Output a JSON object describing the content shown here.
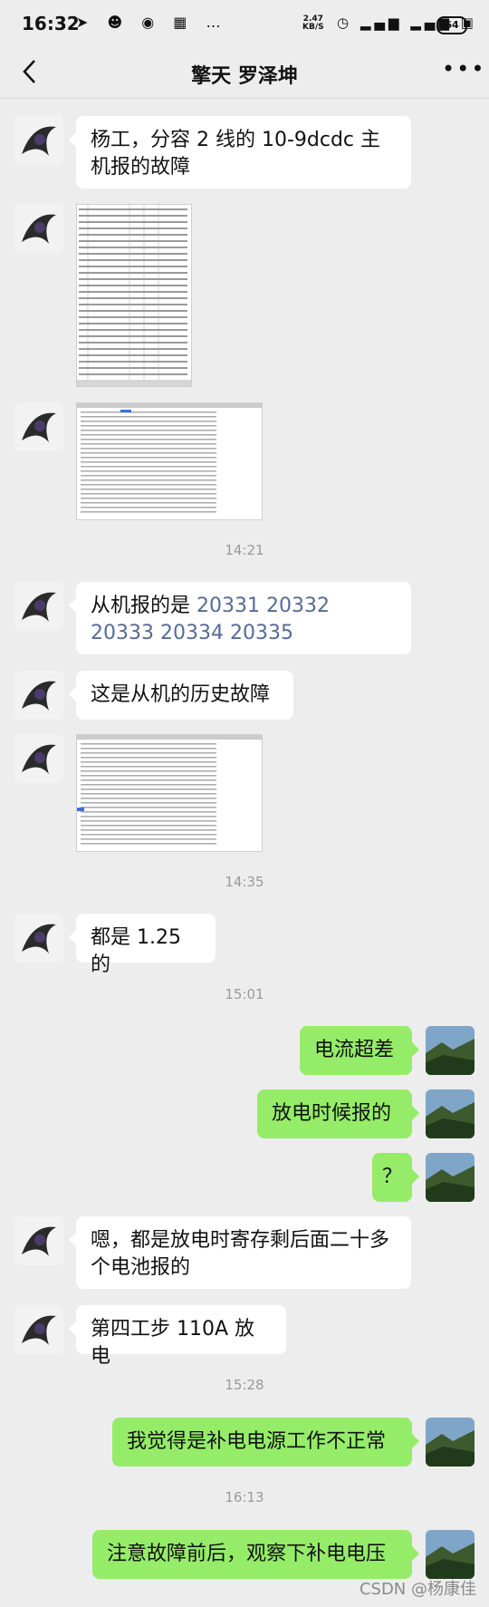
{
  "status_bar": {
    "time": "16:32",
    "net_speed_value": "2.47",
    "net_speed_unit": "KB/S",
    "battery": "64"
  },
  "header": {
    "title": "擎天 罗泽坤"
  },
  "messages": {
    "m1": "杨工，分容 2 线的 10-9dcdc 主机报的故障",
    "m4_prefix": "从机报的是 ",
    "m4_codes": "20331 20332 20333 20334 20335",
    "m5": "这是从机的历史故障",
    "m7": "都是 1.25 的",
    "m8": "电流超差",
    "m9": "放电时候报的",
    "m10": "？",
    "m11": "嗯，都是放电时寄存剩后面二十多个电池报的",
    "m12": "第四工步 110A 放电",
    "m13": "我觉得是补电电源工作不正常",
    "m14": "注意故障前后，观察下补电电压"
  },
  "timestamps": {
    "t1": "14:21",
    "t2": "14:35",
    "t3": "15:01",
    "t4": "15:28",
    "t5": "16:13"
  },
  "watermark": "CSDN @杨康佳",
  "colors": {
    "background": "#ededed",
    "incoming_bubble": "#ffffff",
    "outgoing_bubble": "#95ec69",
    "link": "#576b95"
  }
}
